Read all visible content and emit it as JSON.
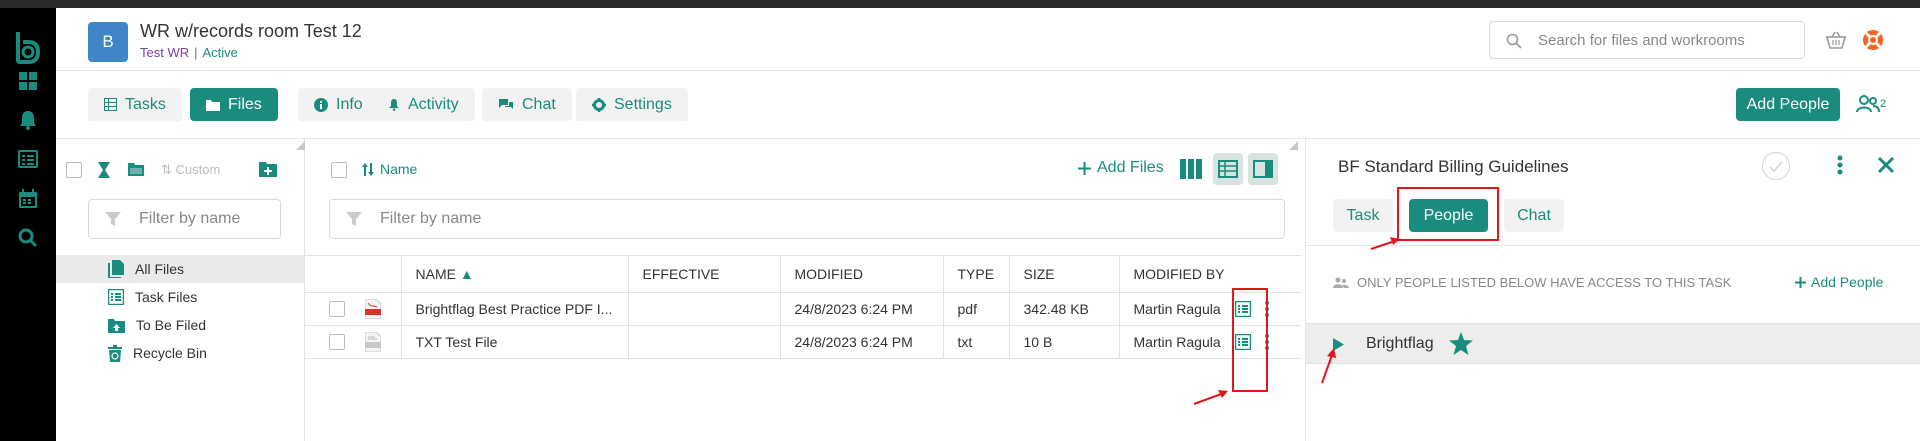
{
  "app": {
    "logo_letter": "b"
  },
  "rail": {
    "icons": [
      "dashboard-icon",
      "bell-icon",
      "list-icon",
      "calendar-icon",
      "search-icon"
    ]
  },
  "workroom": {
    "avatar_letter": "B",
    "title": "WR w/records room Test 12",
    "client": "Test WR",
    "separator": "|",
    "status": "Active"
  },
  "search": {
    "placeholder": "Search for files and workrooms"
  },
  "tabs": [
    {
      "label": "Tasks",
      "icon": "table-icon"
    },
    {
      "label": "Files",
      "icon": "folder-icon",
      "active": true
    },
    {
      "label": "Info",
      "icon": "info-icon"
    },
    {
      "label": "Activity",
      "icon": "bell-icon"
    },
    {
      "label": "Chat",
      "icon": "chat-icon"
    },
    {
      "label": "Settings",
      "icon": "gear-icon"
    }
  ],
  "toolbar": {
    "add_people_label": "Add People",
    "people_count": "2"
  },
  "left_panel": {
    "custom_label": "Custom",
    "filter_placeholder": "Filter by name",
    "tree": [
      {
        "label": "All Files",
        "selected": true
      },
      {
        "label": "Task Files"
      },
      {
        "label": "To Be Filed"
      },
      {
        "label": "Recycle Bin"
      }
    ]
  },
  "files": {
    "sort_label": "Name",
    "add_files_label": "Add Files",
    "filter_placeholder": "Filter by name",
    "columns": [
      "NAME",
      "EFFECTIVE",
      "MODIFIED",
      "TYPE",
      "SIZE",
      "MODIFIED BY"
    ],
    "rows": [
      {
        "name": "Brightflag Best Practice PDF I...",
        "effective": "",
        "modified": "24/8/2023 6:24 PM",
        "type": "pdf",
        "size": "342.48 KB",
        "modified_by": "Martin Ragula"
      },
      {
        "name": "TXT Test File",
        "effective": "",
        "modified": "24/8/2023 6:24 PM",
        "type": "txt",
        "size": "10 B",
        "modified_by": "Martin Ragula"
      }
    ]
  },
  "detail": {
    "title": "BF Standard Billing Guidelines",
    "tabs": [
      "Task",
      "People",
      "Chat"
    ],
    "active_tab": "People",
    "access_note": "ONLY PEOPLE LISTED BELOW HAVE ACCESS TO THIS TASK",
    "add_people_label": "Add People",
    "group_name": "Brightflag"
  },
  "colors": {
    "accent": "#1a8c7e",
    "avatar": "#3f86c6",
    "annotation": "#e0181b",
    "client_text": "#7b3ea6"
  }
}
